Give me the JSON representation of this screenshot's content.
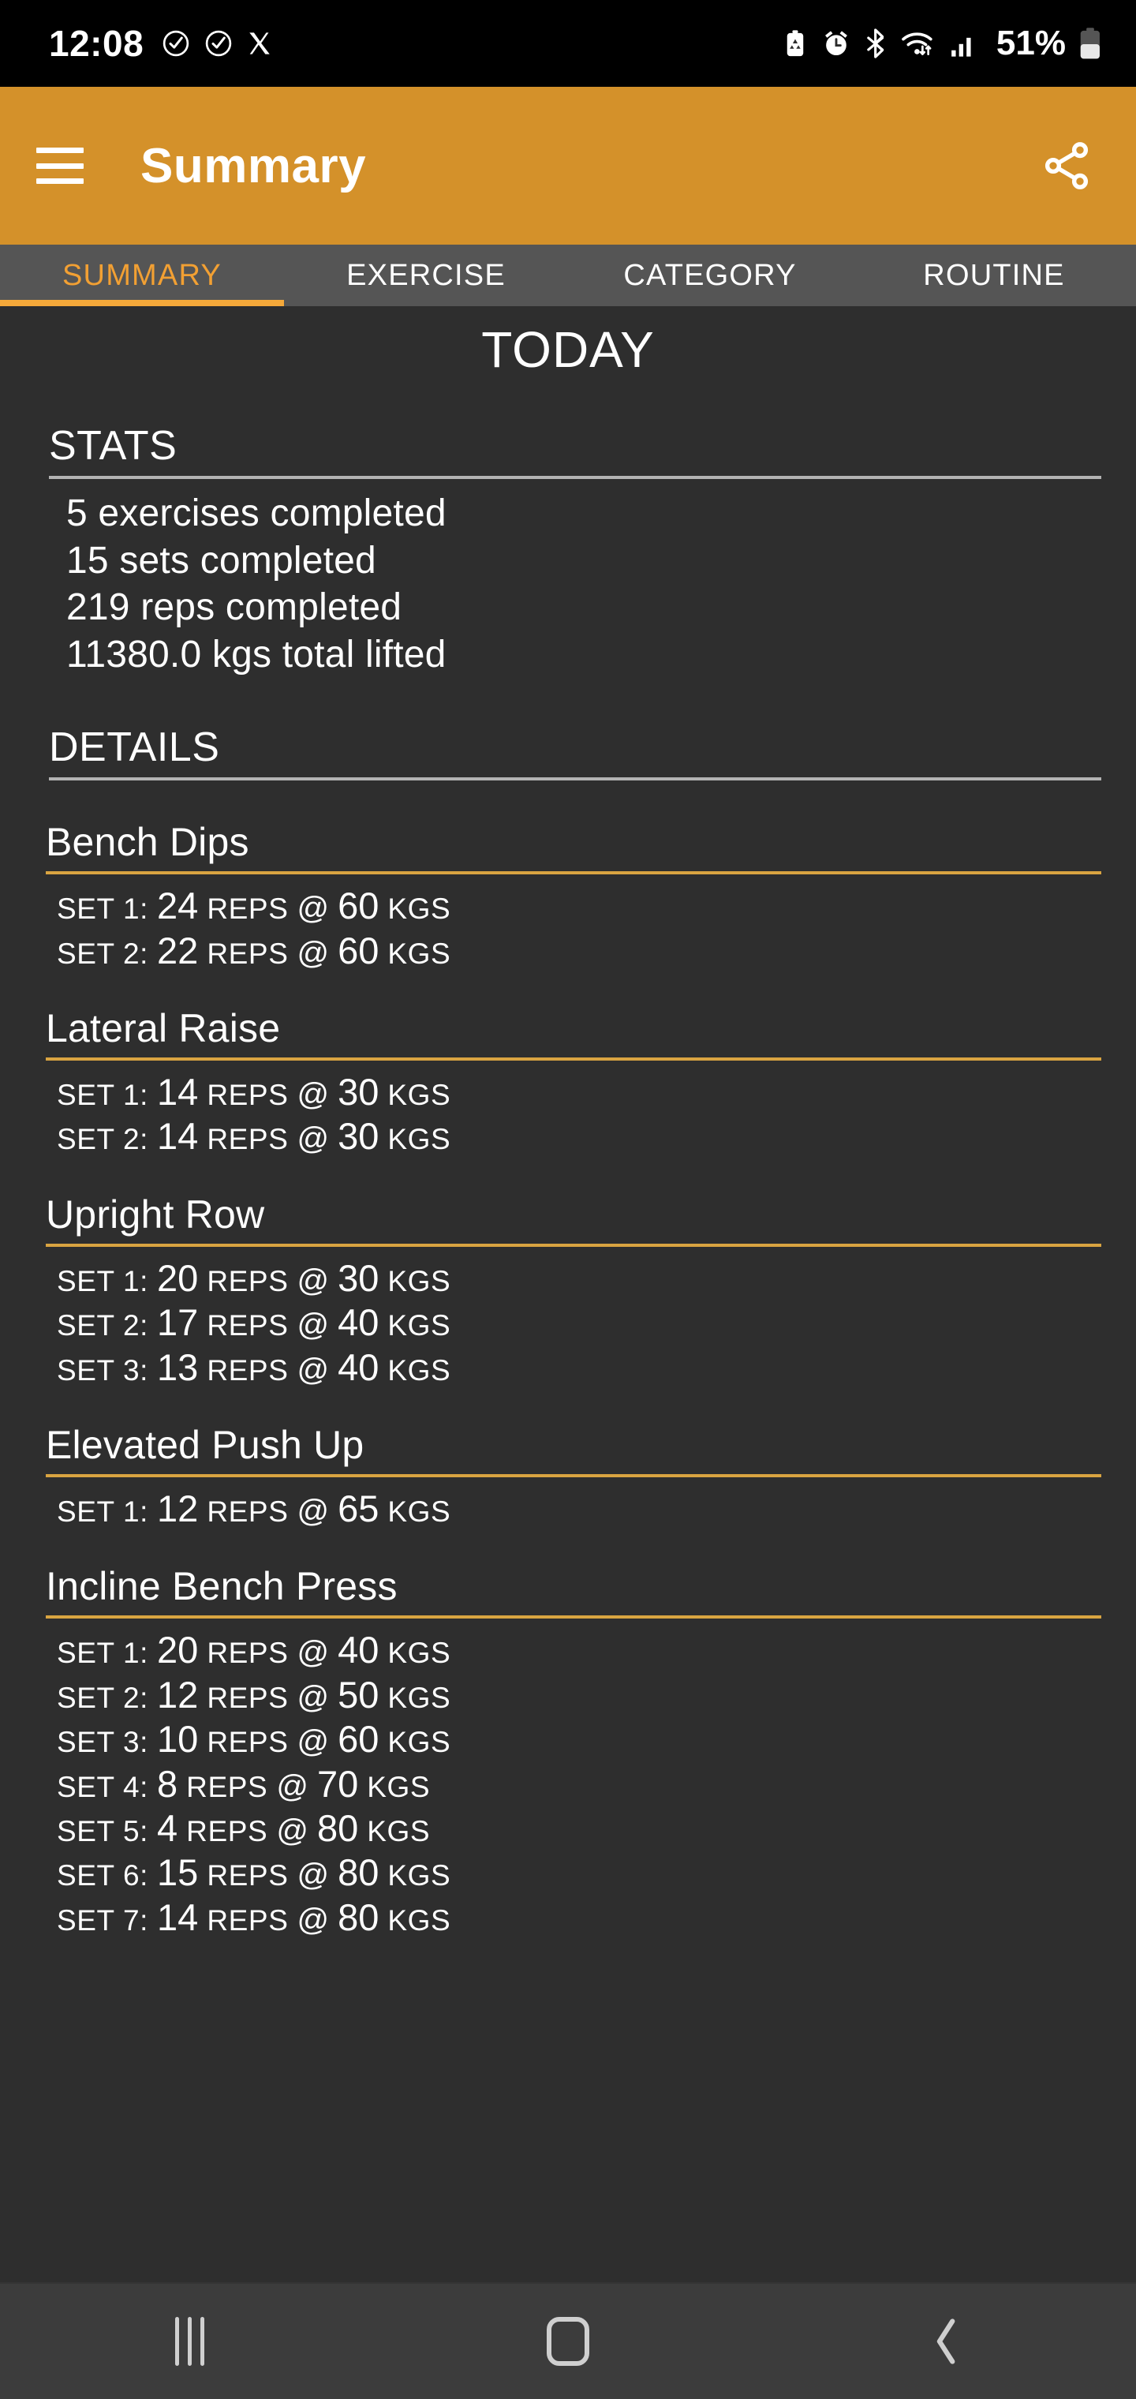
{
  "status_bar": {
    "time": "12:08",
    "battery_percent": "51%",
    "left_icons": [
      "check-circle-icon",
      "check-circle-icon",
      "x-twitter-icon"
    ],
    "right_icons": [
      "battery-saver-icon",
      "alarm-icon",
      "bluetooth-icon",
      "wifi-icon",
      "signal-icon",
      "battery-icon"
    ]
  },
  "app_bar": {
    "title": "Summary",
    "menu_icon": "hamburger-menu-icon",
    "share_icon": "share-icon",
    "background_color": "#d4912a"
  },
  "tabs": {
    "active_index": 0,
    "accent_color": "#f5a93a",
    "items": [
      {
        "label": "SUMMARY"
      },
      {
        "label": "EXERCISE"
      },
      {
        "label": "CATEGORY"
      },
      {
        "label": "ROUTINE"
      }
    ]
  },
  "page_title": "TODAY",
  "stats": {
    "heading": "STATS",
    "lines": [
      "5 exercises completed",
      "15 sets completed",
      "219 reps completed",
      "11380.0 kgs total lifted"
    ]
  },
  "details": {
    "heading": "DETAILS",
    "set_label_prefix": "SET",
    "reps_word": "REPS",
    "at_symbol": "@",
    "weight_unit": "KGS",
    "rule_color": "#d9a441",
    "exercises": [
      {
        "name": "Bench Dips",
        "sets": [
          {
            "index": "1",
            "reps": "24",
            "weight": "60"
          },
          {
            "index": "2",
            "reps": "22",
            "weight": "60"
          }
        ]
      },
      {
        "name": "Lateral Raise",
        "sets": [
          {
            "index": "1",
            "reps": "14",
            "weight": "30"
          },
          {
            "index": "2",
            "reps": "14",
            "weight": "30"
          }
        ]
      },
      {
        "name": "Upright Row",
        "sets": [
          {
            "index": "1",
            "reps": "20",
            "weight": "30"
          },
          {
            "index": "2",
            "reps": "17",
            "weight": "40"
          },
          {
            "index": "3",
            "reps": "13",
            "weight": "40"
          }
        ]
      },
      {
        "name": "Elevated Push Up",
        "sets": [
          {
            "index": "1",
            "reps": "12",
            "weight": "65"
          }
        ]
      },
      {
        "name": "Incline Bench Press",
        "sets": [
          {
            "index": "1",
            "reps": "20",
            "weight": "40"
          },
          {
            "index": "2",
            "reps": "12",
            "weight": "50"
          },
          {
            "index": "3",
            "reps": "10",
            "weight": "60"
          },
          {
            "index": "4",
            "reps": "8",
            "weight": "70"
          },
          {
            "index": "5",
            "reps": "4",
            "weight": "80"
          },
          {
            "index": "6",
            "reps": "15",
            "weight": "80"
          },
          {
            "index": "7",
            "reps": "14",
            "weight": "80"
          }
        ]
      }
    ]
  },
  "nav_bar": {
    "recents_icon": "recents-icon",
    "home_icon": "home-icon",
    "back_icon": "back-icon"
  }
}
